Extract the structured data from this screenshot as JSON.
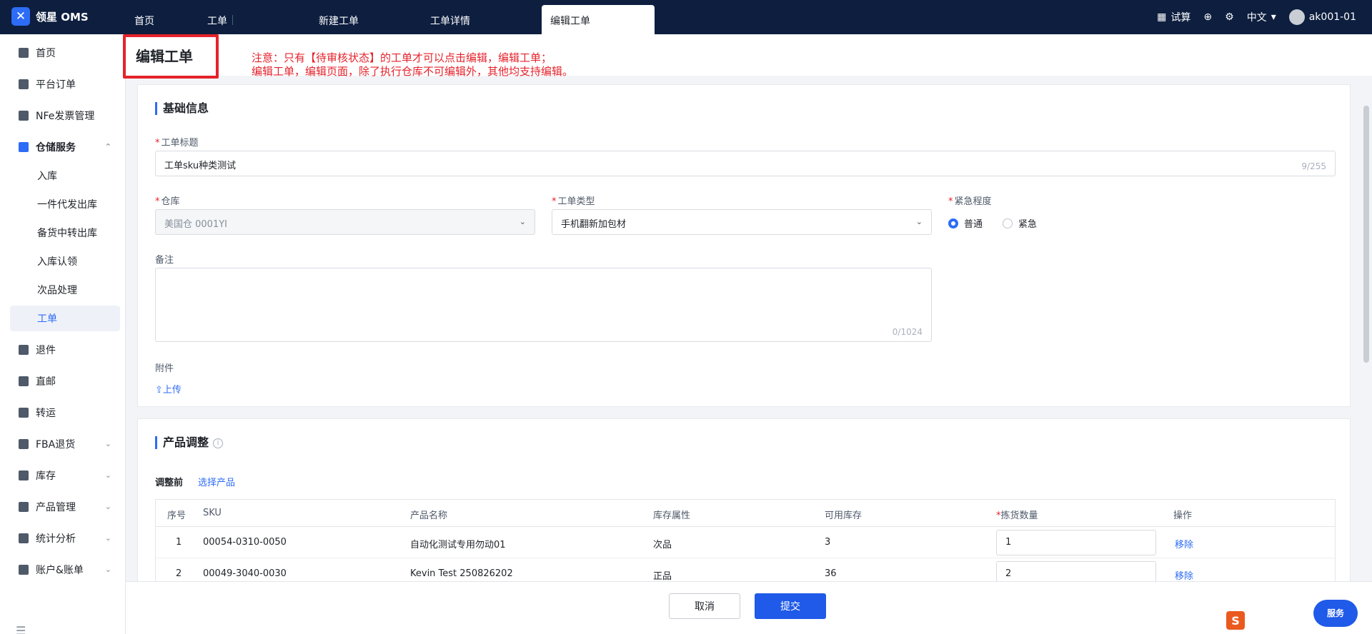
{
  "app": {
    "logo_text": "领星 OMS"
  },
  "tabs": [
    {
      "label": "首页"
    },
    {
      "label": "工单"
    },
    {
      "label": "新建工单"
    },
    {
      "label": "工单详情"
    },
    {
      "label": "编辑工单"
    }
  ],
  "top_right": {
    "calc_label": "试算",
    "lang_label": "中文",
    "user": "ak001-01"
  },
  "sidebar": {
    "items": [
      {
        "label": "首页"
      },
      {
        "label": "平台订单"
      },
      {
        "label": "NFe发票管理"
      },
      {
        "label": "仓储服务"
      },
      {
        "label": "入库"
      },
      {
        "label": "一件代发出库"
      },
      {
        "label": "备货中转出库"
      },
      {
        "label": "入库认领"
      },
      {
        "label": "次品处理"
      },
      {
        "label": "工单"
      },
      {
        "label": "退件"
      },
      {
        "label": "直邮"
      },
      {
        "label": "转运"
      },
      {
        "label": "FBA退货"
      },
      {
        "label": "库存"
      },
      {
        "label": "产品管理"
      },
      {
        "label": "统计分析"
      },
      {
        "label": "账户&账单"
      }
    ]
  },
  "page": {
    "title": "编辑工单",
    "note_line1": "注意：只有【待审核状态】的工单才可以点击编辑，编辑工单；",
    "note_line2": "编辑工单，编辑页面，除了执行仓库不可编辑外，其他均支持编辑。"
  },
  "basic": {
    "section_title": "基础信息",
    "title_label": "工单标题",
    "title_value": "工单sku种类测试",
    "title_count": "9/255",
    "warehouse_label": "仓库",
    "warehouse_value": "美国仓 0001YI",
    "type_label": "工单类型",
    "type_value": "手机翻新加包材",
    "urgency_label": "紧急程度",
    "urgency_normal": "普通",
    "urgency_urgent": "紧急",
    "remark_label": "备注",
    "remark_count": "0/1024",
    "attachment_label": "附件",
    "upload_label": "上传"
  },
  "product": {
    "section_title": "产品调整",
    "before_label": "调整前",
    "select_label": "选择产品",
    "columns": [
      "序号",
      "SKU",
      "产品名称",
      "库存属性",
      "可用库存",
      "拣货数量",
      "操作"
    ],
    "rows": [
      {
        "no": "1",
        "sku": "00054-0310-0050",
        "name": "自动化测试专用勿动01",
        "attr": "次品",
        "stock": "3",
        "qty": "1",
        "action": "移除"
      },
      {
        "no": "2",
        "sku": "00049-3040-0030",
        "name": "Kevin Test 250826202",
        "attr": "正品",
        "stock": "36",
        "qty": "2",
        "action": "移除"
      }
    ]
  },
  "footer": {
    "cancel_label": "取消",
    "submit_label": "提交"
  },
  "help": {
    "label": "服务"
  },
  "colors": {
    "accent": "#2d6cf6",
    "topbar": "#0d1e3f",
    "warning": "#e5222b"
  }
}
